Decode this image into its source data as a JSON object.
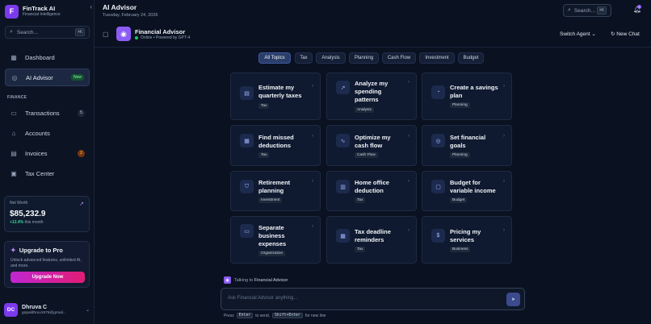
{
  "brand": {
    "logo_letter": "F",
    "name": "FinTrack AI",
    "subtitle": "Financial Intelligence"
  },
  "sidebar": {
    "search_placeholder": "Search...",
    "search_shortcut": "⌘K",
    "section_finance": "FINANCE",
    "items": [
      {
        "label": "Dashboard",
        "icon": "grid-icon"
      },
      {
        "label": "AI Advisor",
        "icon": "bot-icon",
        "badge": "New",
        "active": true
      },
      {
        "label": "Transactions",
        "icon": "credit-card-icon",
        "badge": "5"
      },
      {
        "label": "Accounts",
        "icon": "bank-icon"
      },
      {
        "label": "Invoices",
        "icon": "file-icon",
        "badge": "2"
      },
      {
        "label": "Tax Center",
        "icon": "calculator-icon"
      }
    ]
  },
  "net_worth": {
    "label": "Net Worth",
    "value": "$85,232.9",
    "change": "+12.4%",
    "change_suffix": "this month"
  },
  "upgrade": {
    "title": "Upgrade to Pro",
    "description": "Unlock advanced features, unlimited AI, and more.",
    "button": "Upgrade Now"
  },
  "user": {
    "initials": "DC",
    "name": "Dhruva C",
    "email": "gopaldhruv1975@gmail..."
  },
  "header": {
    "title": "AI Advisor",
    "date": "Tuesday, February 24, 2026",
    "search_placeholder": "Search...",
    "search_shortcut": "⌘K",
    "notification_count": "3"
  },
  "advisor": {
    "name": "Financial Advisor",
    "status": "Online • Powered by GPT-4",
    "switch_agent": "Switch Agent",
    "new_chat": "New Chat"
  },
  "tabs": [
    "All Topics",
    "Tax",
    "Analysis",
    "Planning",
    "Cash Flow",
    "Investment",
    "Budget"
  ],
  "cards": [
    {
      "title": "Estimate my quarterly taxes",
      "tag": "Tax"
    },
    {
      "title": "Analyze my spending patterns",
      "tag": "Analysis"
    },
    {
      "title": "Create a savings plan",
      "tag": "Planning"
    },
    {
      "title": "Find missed deductions",
      "tag": "Tax"
    },
    {
      "title": "Optimize my cash flow",
      "tag": "Cash Flow"
    },
    {
      "title": "Set financial goals",
      "tag": "Planning"
    },
    {
      "title": "Retirement planning",
      "tag": "Investment"
    },
    {
      "title": "Home office deduction",
      "tag": "Tax"
    },
    {
      "title": "Budget for variable income",
      "tag": "Budget"
    },
    {
      "title": "Separate business expenses",
      "tag": "Organization"
    },
    {
      "title": "Tax deadline reminders",
      "tag": "Tax"
    },
    {
      "title": "Pricing my services",
      "tag": "Business"
    }
  ],
  "composer": {
    "talking_prefix": "Talking to",
    "talking_agent": "Financial Advisor",
    "placeholder": "Ask Financial Advisor anything...",
    "hint_press": "Press",
    "hint_enter": "Enter",
    "hint_send": "to send,",
    "hint_shift": "Shift+Enter",
    "hint_newline": "for new line"
  },
  "colors": {
    "accent": "#8b5cf6",
    "background": "#0a1120",
    "card": "#0f1a30",
    "positive": "#34d399"
  }
}
